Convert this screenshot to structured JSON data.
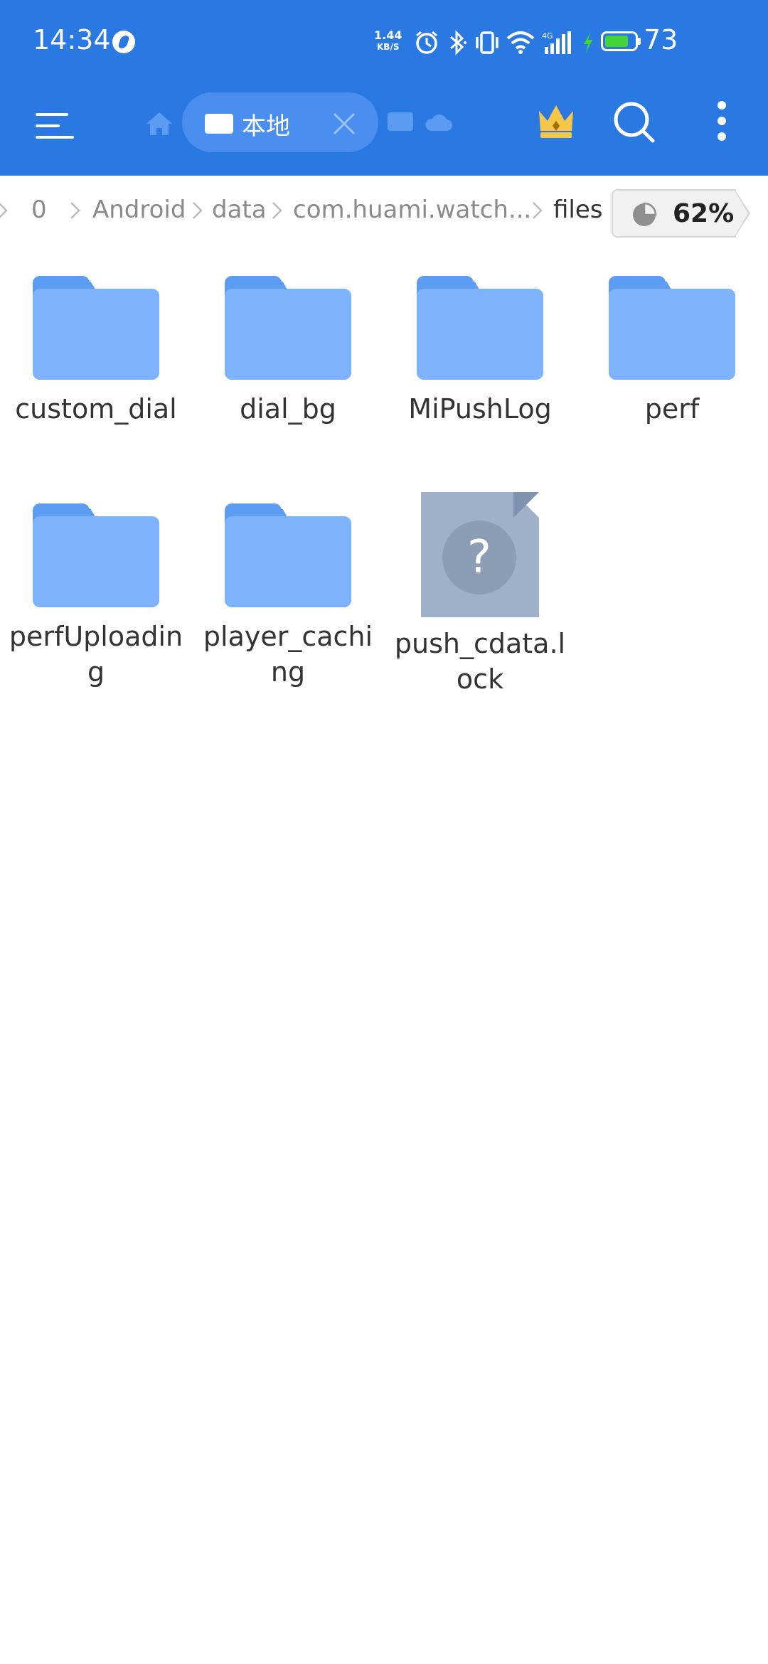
{
  "status_bar": {
    "time": "14:34",
    "net_speed_value": "1.44",
    "net_speed_unit": "KB/S",
    "network_type": "4G",
    "battery": "73",
    "colors": {
      "background": "#2a78e1",
      "battery_fill": "#43d43a"
    }
  },
  "toolbar": {
    "menu_icon": "hamburger-icon",
    "home_icon": "home-icon",
    "local_tab_label": "本地",
    "close_icon": "close-icon",
    "sd_icon": "sd-card-icon",
    "cloud_icon": "cloud-icon",
    "vip_icon": "crown-icon",
    "search_icon": "search-icon",
    "more_icon": "more-vertical-icon"
  },
  "breadcrumb": {
    "items": [
      "0",
      "Android",
      "data",
      "com.huami.watch...",
      "files"
    ],
    "storage_usage": "62%",
    "storage_fraction": 0.62
  },
  "files": [
    {
      "name": "custom_dial",
      "type": "folder"
    },
    {
      "name": "dial_bg",
      "type": "folder"
    },
    {
      "name": "MiPushLog",
      "type": "folder"
    },
    {
      "name": "perf",
      "type": "folder"
    },
    {
      "name": "perfUploading",
      "type": "folder"
    },
    {
      "name": "player_caching",
      "type": "folder"
    },
    {
      "name": "push_cdata.lock",
      "type": "unknown-file"
    }
  ]
}
